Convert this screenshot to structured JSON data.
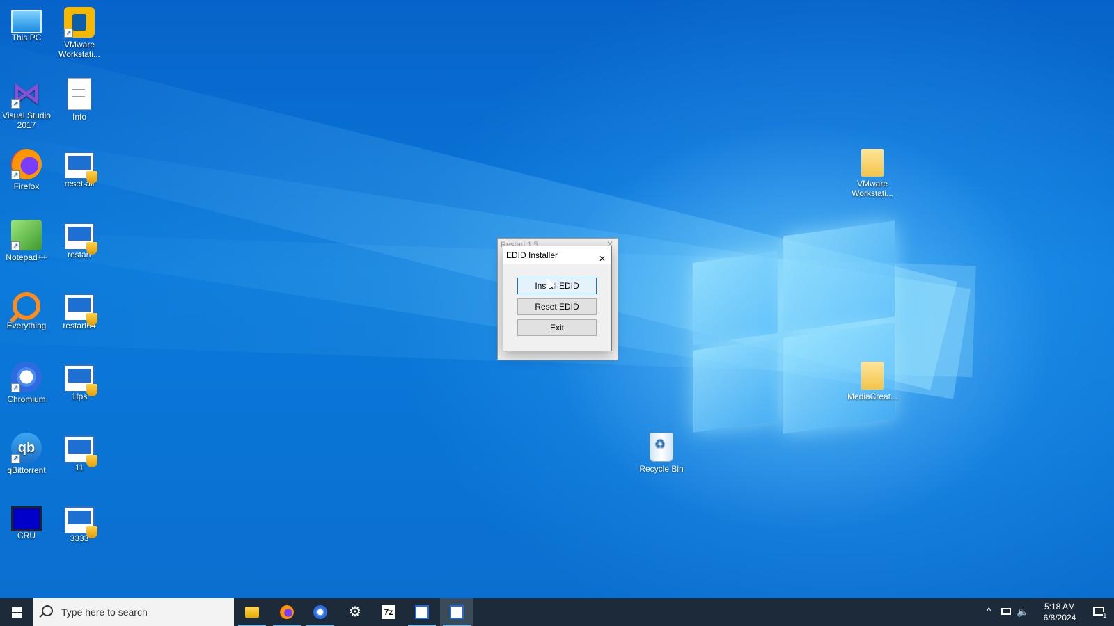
{
  "desktop": {
    "icons": [
      {
        "label": "This PC"
      },
      {
        "label": "VMware Workstati..."
      },
      {
        "label": "Visual Studio 2017"
      },
      {
        "label": "Info"
      },
      {
        "label": "Firefox"
      },
      {
        "label": "reset-all"
      },
      {
        "label": "Notepad++"
      },
      {
        "label": "restart"
      },
      {
        "label": "Everything"
      },
      {
        "label": "restart64"
      },
      {
        "label": "Chromium"
      },
      {
        "label": "1fps"
      },
      {
        "label": "qBittorrent"
      },
      {
        "label": "11"
      },
      {
        "label": "CRU"
      },
      {
        "label": "3333"
      },
      {
        "label": "VMware Workstati..."
      },
      {
        "label": "MediaCreat..."
      },
      {
        "label": "Recycle Bin"
      }
    ]
  },
  "back_dialog": {
    "title": "Restart 1.5"
  },
  "dialog": {
    "title": "EDID Installer",
    "buttons": {
      "install": "Install EDID",
      "reset": "Reset EDID",
      "exit": "Exit"
    }
  },
  "taskbar": {
    "search_placeholder": "Type here to search",
    "apps": [
      "file-explorer-icon",
      "firefox-icon",
      "chromium-icon",
      "settings-icon",
      "7zip-icon",
      "batch-window-icon",
      "edid-installer-icon"
    ],
    "sevenzip_label": "7z",
    "clock": {
      "time": "5:18 AM",
      "date": "6/8/2024"
    },
    "notification_count": "1"
  },
  "colors": {
    "taskbar": "#1c2a3a",
    "desktop": "#0a78d8",
    "accent": "#0078d7"
  }
}
